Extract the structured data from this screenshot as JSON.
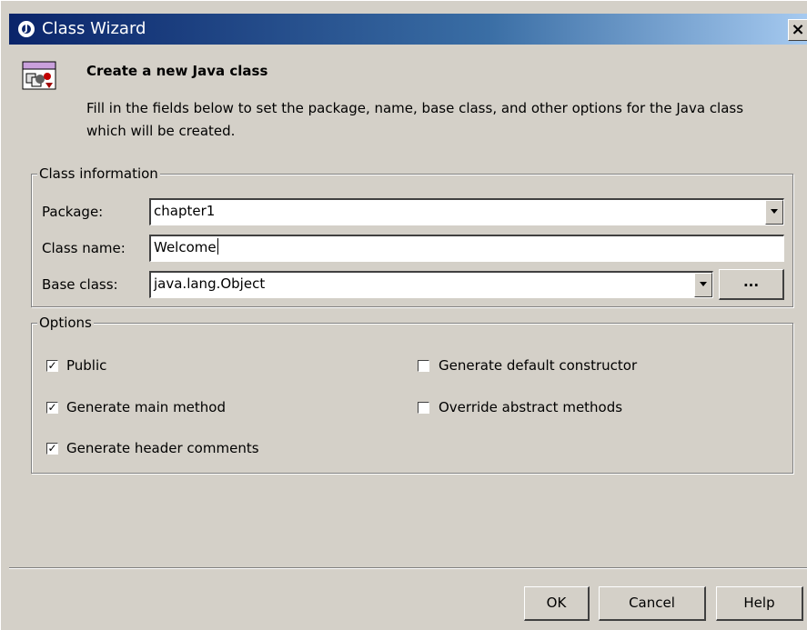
{
  "window": {
    "title": "Class Wizard",
    "close_label": "×"
  },
  "header": {
    "title": "Create a new Java class",
    "description": "Fill in the fields below to set the package, name, base class, and other options for the Java class which will be created."
  },
  "class_info": {
    "legend": "Class information",
    "package_label": "Package:",
    "package_value": "chapter1",
    "class_name_label": "Class name:",
    "class_name_value": "Welcome",
    "base_class_label": "Base class:",
    "base_class_value": "java.lang.Object",
    "browse_label": "..."
  },
  "options": {
    "legend": "Options",
    "public": {
      "label": "Public",
      "checked": true
    },
    "generate_main": {
      "label": "Generate main method",
      "checked": true
    },
    "generate_header": {
      "label": "Generate header comments",
      "checked": true
    },
    "default_constructor": {
      "label": "Generate default constructor",
      "checked": false
    },
    "override_abstract": {
      "label": "Override abstract methods",
      "checked": false
    }
  },
  "buttons": {
    "ok": "OK",
    "cancel": "Cancel",
    "help": "Help"
  },
  "icons": {
    "title": "jbuilder-icon",
    "header": "class-wizard-icon"
  }
}
